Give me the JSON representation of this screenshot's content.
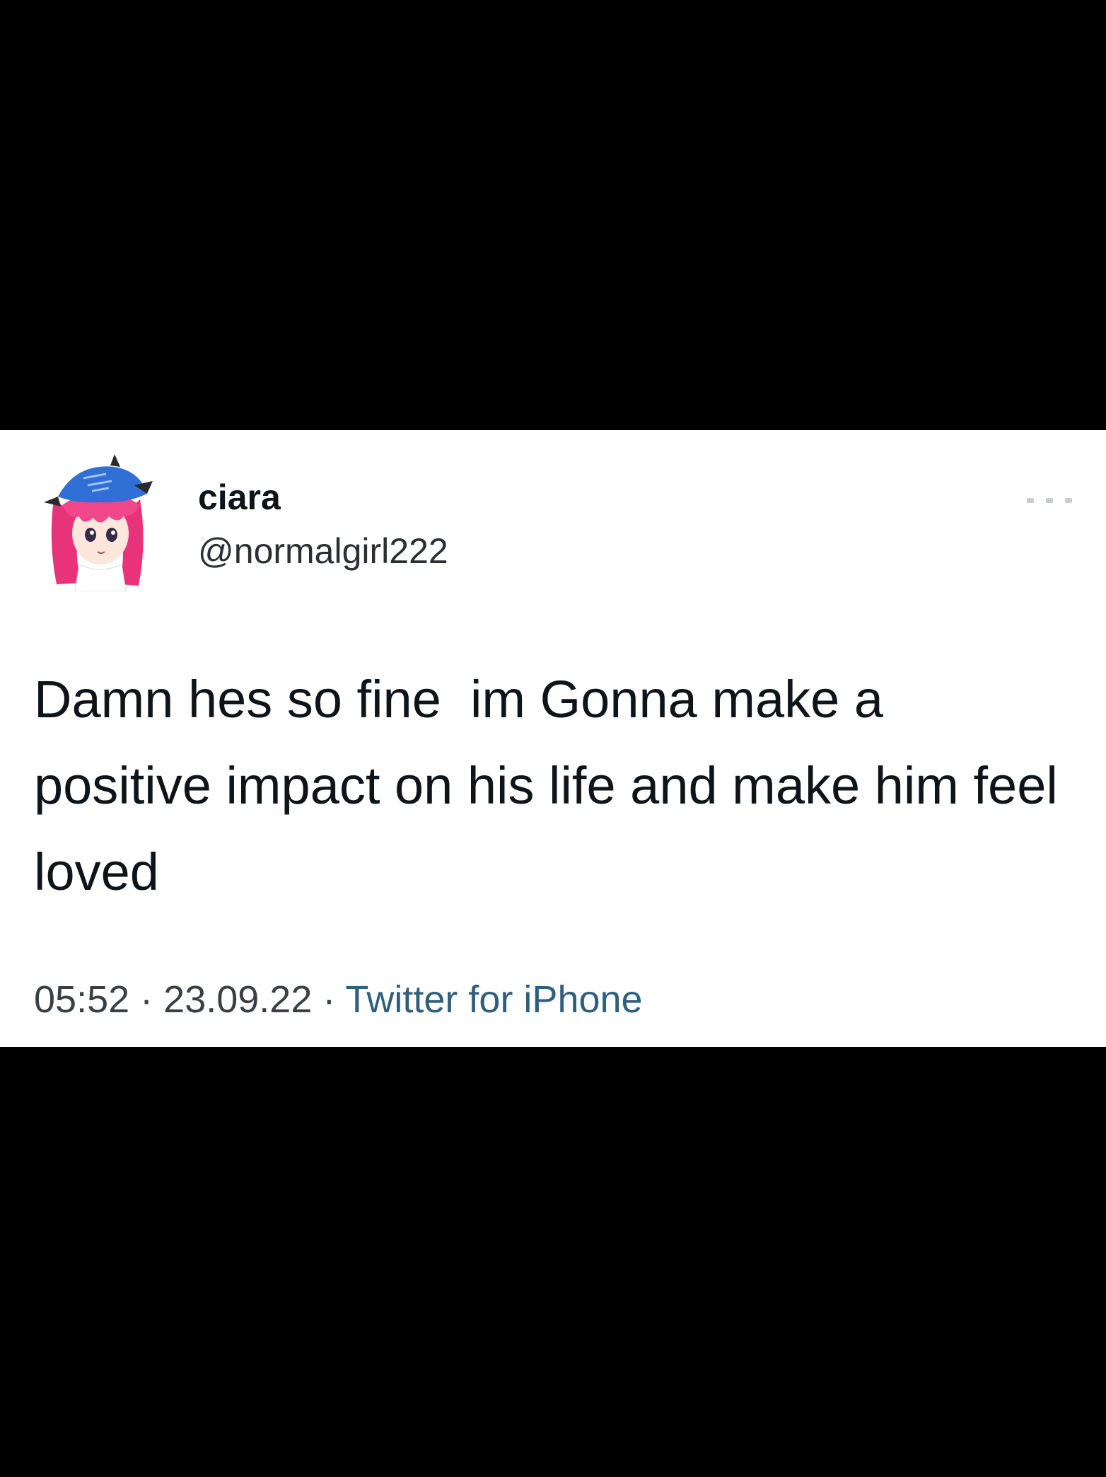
{
  "tweet": {
    "display_name": "ciara",
    "handle": "@normalgirl222",
    "text": "Damn hes so fine  im Gonna make a positive impact on his life and make him feel loved",
    "time": "05:52",
    "date": "23.09.22",
    "separator": "·",
    "source": "Twitter for iPhone",
    "avatar_icon": "anime-girl-avatar",
    "more_icon": "more-options-icon"
  },
  "colors": {
    "background_bars": "#000000",
    "card": "#ffffff",
    "text": "#0f1419",
    "source_link": "#2f5f7f",
    "avatar_hair": "#e8327a",
    "avatar_cap": "#2f6fd6"
  }
}
